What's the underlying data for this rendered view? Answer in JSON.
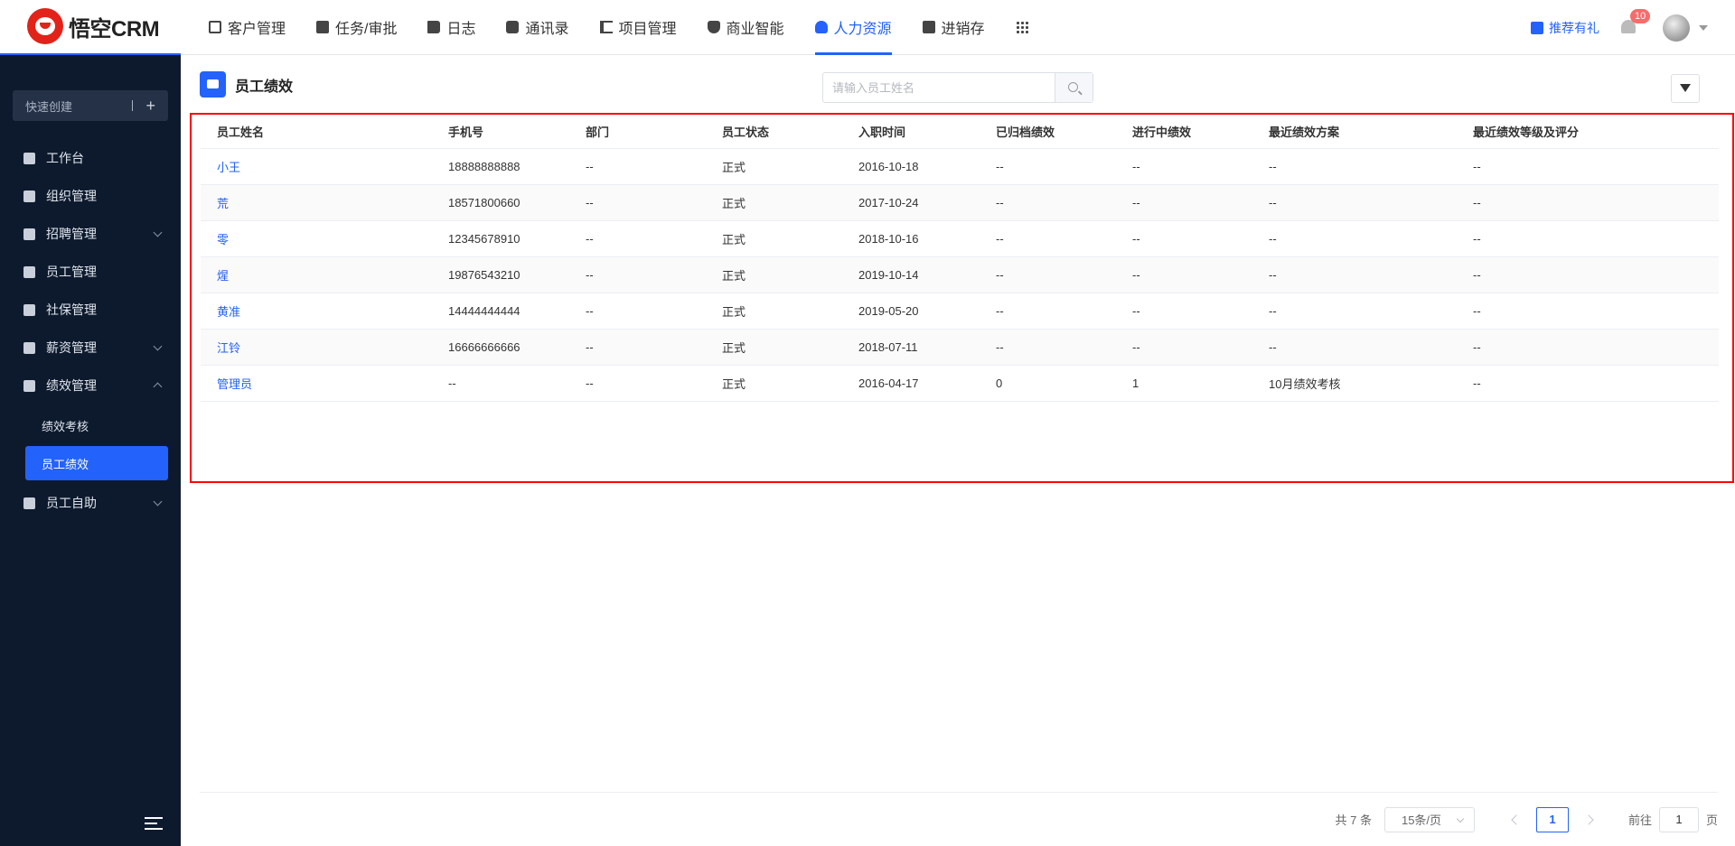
{
  "app": {
    "logo_text": "悟空CRM"
  },
  "nav": {
    "items": [
      {
        "label": "客户管理",
        "icon": "building-icon"
      },
      {
        "label": "任务/审批",
        "icon": "briefcase-icon"
      },
      {
        "label": "日志",
        "icon": "notebook-icon"
      },
      {
        "label": "通讯录",
        "icon": "phone-book-icon"
      },
      {
        "label": "项目管理",
        "icon": "project-icon"
      },
      {
        "label": "商业智能",
        "icon": "shield-chart-icon"
      },
      {
        "label": "人力资源",
        "icon": "people-icon",
        "active": true
      },
      {
        "label": "进销存",
        "icon": "truck-icon"
      }
    ],
    "more_icon": "grid-icon"
  },
  "header_right": {
    "gift_label": "推荐有礼",
    "notification_count": "10"
  },
  "sidebar": {
    "quick_create": "快速创建",
    "items": [
      {
        "label": "工作台"
      },
      {
        "label": "组织管理"
      },
      {
        "label": "招聘管理",
        "expandable": true
      },
      {
        "label": "员工管理"
      },
      {
        "label": "社保管理"
      },
      {
        "label": "薪资管理",
        "expandable": true
      },
      {
        "label": "绩效管理",
        "expandable": true,
        "expanded": true
      },
      {
        "label": "员工自助",
        "expandable": true
      }
    ],
    "sub_items": [
      {
        "label": "绩效考核"
      },
      {
        "label": "员工绩效",
        "active": true
      }
    ]
  },
  "page": {
    "title": "员工绩效",
    "search_placeholder": "请输入员工姓名"
  },
  "table": {
    "columns": [
      "员工姓名",
      "手机号",
      "部门",
      "员工状态",
      "入职时间",
      "已归档绩效",
      "进行中绩效",
      "最近绩效方案",
      "最近绩效等级及评分"
    ],
    "rows": [
      [
        "小王",
        "18888888888",
        "--",
        "正式",
        "2016-10-18",
        "--",
        "--",
        "--",
        "--"
      ],
      [
        "荒",
        "18571800660",
        "--",
        "正式",
        "2017-10-24",
        "--",
        "--",
        "--",
        "--"
      ],
      [
        "零",
        "12345678910",
        "--",
        "正式",
        "2018-10-16",
        "--",
        "--",
        "--",
        "--"
      ],
      [
        "煋",
        "19876543210",
        "--",
        "正式",
        "2019-10-14",
        "--",
        "--",
        "--",
        "--"
      ],
      [
        "黄准",
        "14444444444",
        "--",
        "正式",
        "2019-05-20",
        "--",
        "--",
        "--",
        "--"
      ],
      [
        "江铃",
        "16666666666",
        "--",
        "正式",
        "2018-07-11",
        "--",
        "--",
        "--",
        "--"
      ],
      [
        "管理员",
        "--",
        "--",
        "正式",
        "2016-04-17",
        "0",
        "1",
        "10月绩效考核",
        "--"
      ]
    ]
  },
  "pagination": {
    "total": "共 7 条",
    "page_size": "15条/页",
    "current_page": "1",
    "goto_label": "前往",
    "goto_value": "1",
    "goto_suffix": "页"
  },
  "colors": {
    "accent": "#2362fb",
    "sidebar_bg": "#0d1a2e",
    "highlight_border": "#ff0000"
  }
}
